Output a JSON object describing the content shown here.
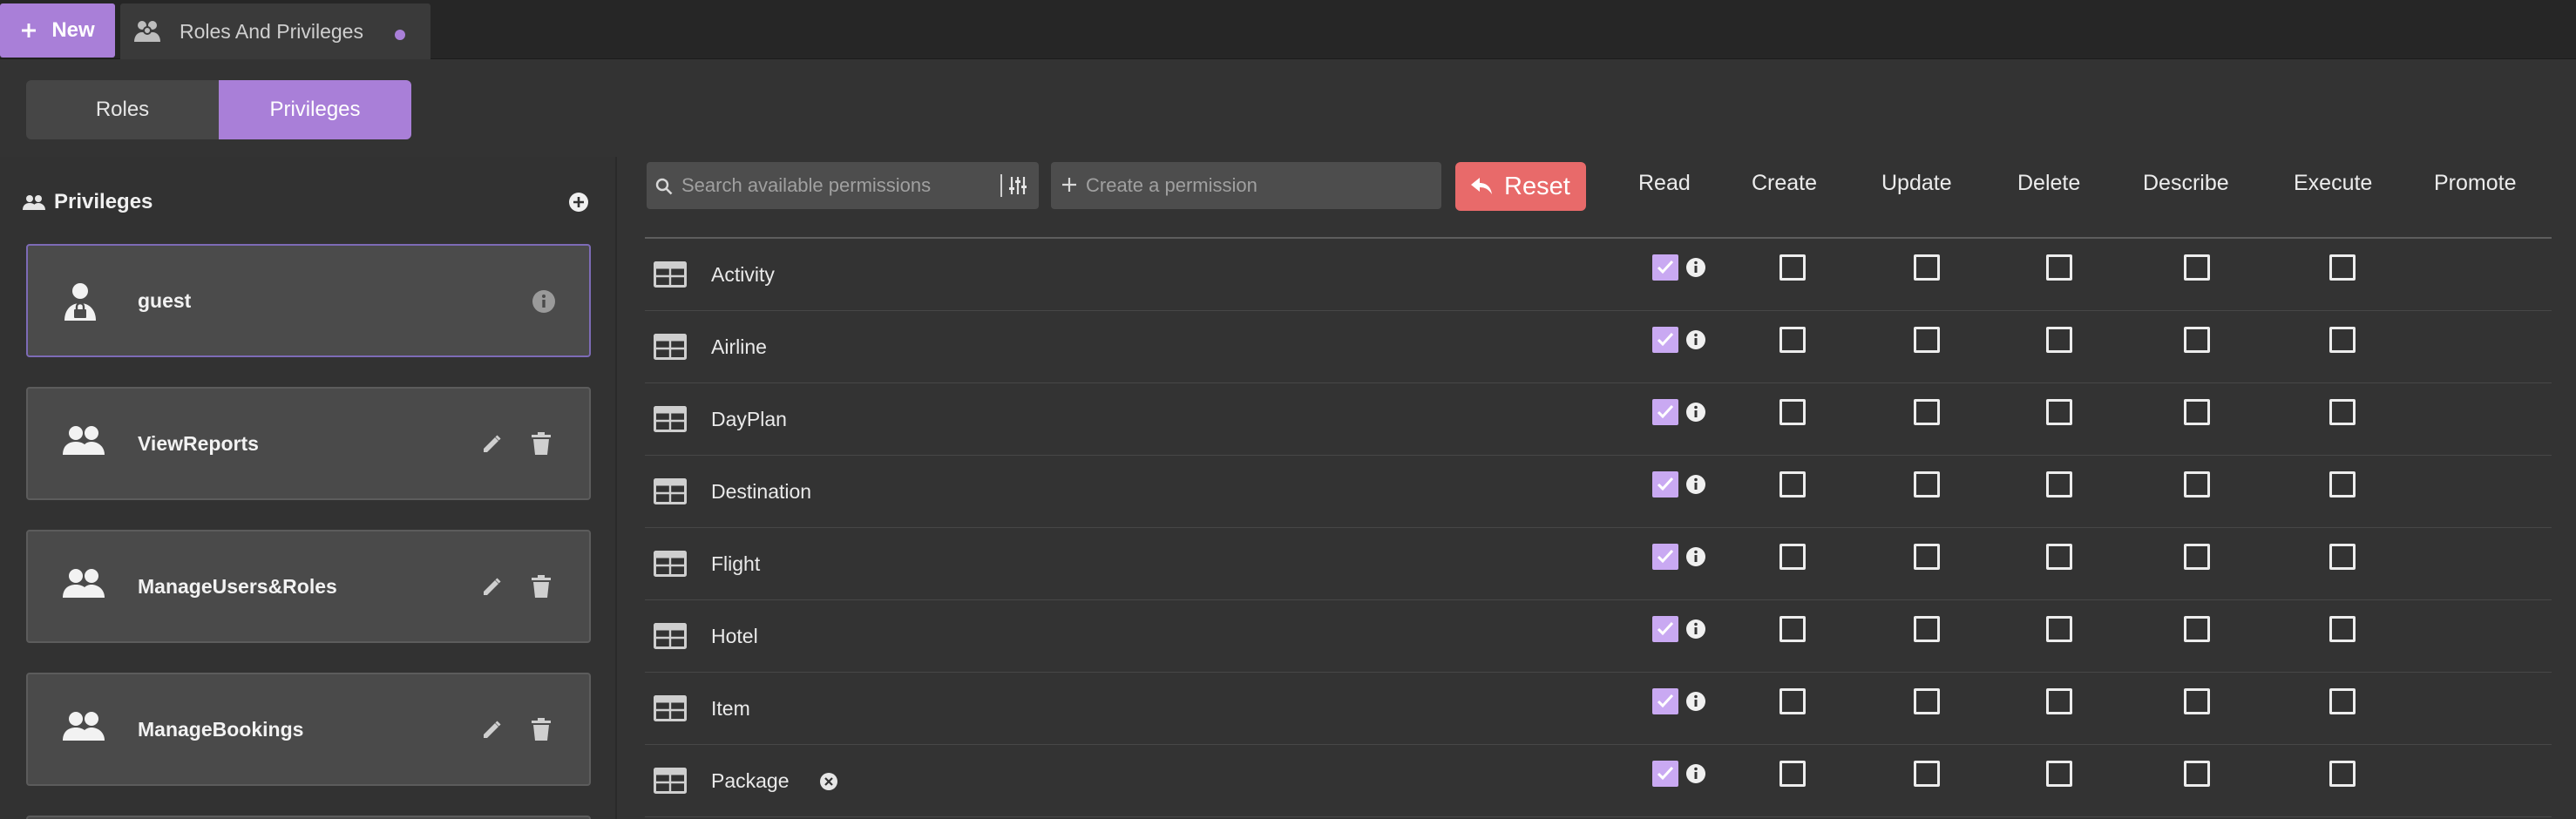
{
  "topbar": {
    "new_label": "New",
    "tab_label": "Roles And Privileges",
    "tab_modified": true
  },
  "segmented": {
    "tabs": [
      {
        "label": "Roles",
        "active": false
      },
      {
        "label": "Privileges",
        "active": true
      }
    ]
  },
  "sidebar": {
    "title": "Privileges",
    "roles": [
      {
        "name": "guest",
        "icon": "user-lock-icon",
        "selected": true
      },
      {
        "name": "ViewReports",
        "icon": "people-icon",
        "selected": false
      },
      {
        "name": "ManageUsers&Roles",
        "icon": "people-icon",
        "selected": false
      },
      {
        "name": "ManageBookings",
        "icon": "people-icon",
        "selected": false
      }
    ]
  },
  "toolbar": {
    "search_placeholder": "Search available permissions",
    "search_value": "",
    "create_placeholder": "Create a permission",
    "create_value": "",
    "reset_label": "Reset"
  },
  "columns": [
    "Read",
    "Create",
    "Update",
    "Delete",
    "Describe",
    "Execute",
    "Promote"
  ],
  "rows": [
    {
      "name": "Activity",
      "perms": [
        true,
        false,
        false,
        false,
        false,
        false
      ]
    },
    {
      "name": "Airline",
      "perms": [
        true,
        false,
        false,
        false,
        false,
        false
      ]
    },
    {
      "name": "DayPlan",
      "perms": [
        true,
        false,
        false,
        false,
        false,
        false
      ]
    },
    {
      "name": "Destination",
      "perms": [
        true,
        false,
        false,
        false,
        false,
        false
      ]
    },
    {
      "name": "Flight",
      "perms": [
        true,
        false,
        false,
        false,
        false,
        false
      ]
    },
    {
      "name": "Hotel",
      "perms": [
        true,
        false,
        false,
        false,
        false,
        false
      ]
    },
    {
      "name": "Item",
      "perms": [
        true,
        false,
        false,
        false,
        false,
        false
      ]
    },
    {
      "name": "Package",
      "perms": [
        true,
        false,
        false,
        false,
        false,
        false
      ],
      "removable": true
    }
  ],
  "colors": {
    "accent": "#a97fd8",
    "checked": "#c9a9f2",
    "reset": "#e86a6a",
    "background": "#333333"
  }
}
